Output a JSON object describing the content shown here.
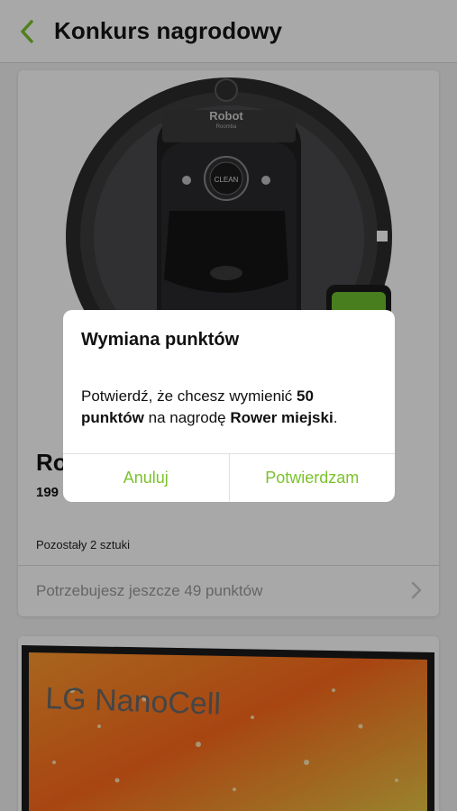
{
  "header": {
    "title": "Konkurs nagrodowy",
    "back_icon": "chevron-left-icon",
    "accent": "#7cc22d"
  },
  "product": {
    "title_visible": "Ro",
    "points_visible": "199",
    "remaining": "Pozostały 2 sztuki",
    "need_more": "Potrzebujesz jeszcze 49 punktów",
    "image_brand": "Robot",
    "image_model": "Roomba",
    "image_button": "CLEAN"
  },
  "second_product": {
    "image_text": "LG NanoCell"
  },
  "dialog": {
    "title": "Wymiana punktów",
    "message_prefix": "Potwierdź, że chcesz wymienić ",
    "message_points": "50 punktów",
    "message_middle": " na nagrodę ",
    "message_reward": "Rower miejski",
    "message_suffix": ".",
    "cancel_label": "Anuluj",
    "confirm_label": "Potwierdzam",
    "button_color": "#7cc22d"
  }
}
